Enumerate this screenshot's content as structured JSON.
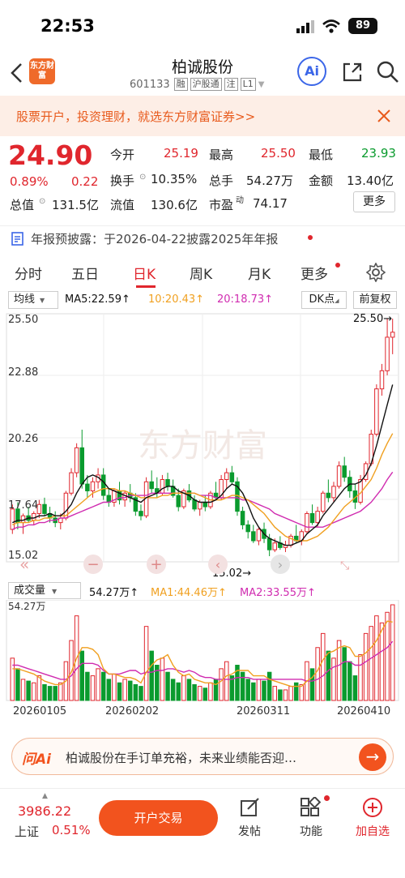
{
  "status_bar": {
    "time": "22:53",
    "battery": "89"
  },
  "header": {
    "logo_text": "东方财富",
    "title": "柏诚股份",
    "code": "601133",
    "tags": [
      "融",
      "沪股通",
      "注",
      "L1"
    ]
  },
  "promo": {
    "text": "股票开户，投资理财，就选东方财富证券>>"
  },
  "quote": {
    "price": "24.90",
    "change_pct": "0.89%",
    "change": "0.22",
    "open_label": "今开",
    "open": "25.19",
    "high_label": "最高",
    "high": "25.50",
    "low_label": "最低",
    "low": "23.93",
    "turnover_label": "换手",
    "turnover": "10.35%",
    "volume_label": "总手",
    "volume": "54.27万",
    "amount_label": "金额",
    "amount": "13.40亿",
    "total_cap_label": "总值",
    "total_cap": "131.5亿",
    "float_cap_label": "流值",
    "float_cap": "130.6亿",
    "pe_label": "市盈",
    "pe_sup": "动",
    "pe": "74.17",
    "more_label": "更多"
  },
  "notice": {
    "text": "年报预披露：于2026-04-22披露2025年年报"
  },
  "tabs": [
    {
      "label": "分时"
    },
    {
      "label": "五日"
    },
    {
      "label": "日K"
    },
    {
      "label": "周K"
    },
    {
      "label": "月K"
    },
    {
      "label": "更多"
    }
  ],
  "chart_controls": {
    "ma_select": "均线",
    "ma5": "MA5:22.59↑",
    "ma10": "10:20.43↑",
    "ma20": "20:18.73↑",
    "dk_label": "DK点",
    "adjust_label": "前复权"
  },
  "vol_controls": {
    "select": "成交量",
    "vol": "54.27万↑",
    "ma1": "MA1:44.46万↑",
    "ma2": "MA2:33.55万↑",
    "vol_max": "54.27万"
  },
  "colors": {
    "up": "#e0262d",
    "down": "#0a9b2e",
    "ma5": "#111111",
    "ma10": "#f0a020",
    "ma20": "#d02cb0",
    "accent": "#f2531e"
  },
  "chart_data": {
    "type": "candlestick",
    "y_ticks": [
      "25.50",
      "22.88",
      "20.26",
      "17.64",
      "15.02"
    ],
    "ylim": [
      15.02,
      25.5
    ],
    "max_label": "25.50→",
    "min_label": "15.02→",
    "watermark": "东方财富",
    "x_ticks": [
      "20260105",
      "20260202",
      "20260311",
      "20260410"
    ],
    "candles": [
      [
        16.2,
        17.3,
        16.0,
        17.1
      ],
      [
        17.1,
        17.4,
        16.2,
        16.5
      ],
      [
        16.5,
        16.9,
        16.0,
        16.8
      ],
      [
        16.8,
        17.2,
        16.5,
        16.6
      ],
      [
        16.6,
        17.0,
        16.4,
        16.9
      ],
      [
        16.9,
        17.5,
        16.7,
        17.3
      ],
      [
        17.3,
        17.6,
        16.8,
        16.9
      ],
      [
        16.9,
        17.2,
        16.5,
        16.7
      ],
      [
        16.7,
        17.0,
        16.3,
        16.5
      ],
      [
        16.5,
        16.9,
        16.2,
        16.7
      ],
      [
        16.7,
        17.9,
        16.6,
        17.8
      ],
      [
        17.8,
        18.9,
        17.7,
        18.7
      ],
      [
        18.7,
        20.0,
        18.5,
        19.8
      ],
      [
        19.8,
        20.6,
        18.0,
        18.2
      ],
      [
        18.2,
        18.6,
        17.6,
        17.9
      ],
      [
        17.9,
        18.5,
        17.6,
        18.3
      ],
      [
        18.3,
        18.9,
        18.0,
        18.6
      ],
      [
        18.6,
        18.9,
        17.5,
        17.7
      ],
      [
        17.7,
        18.0,
        17.2,
        17.4
      ],
      [
        17.4,
        18.0,
        17.2,
        17.9
      ],
      [
        17.9,
        18.3,
        17.3,
        17.5
      ],
      [
        17.5,
        17.9,
        17.2,
        17.8
      ],
      [
        17.8,
        18.2,
        17.4,
        17.6
      ],
      [
        17.6,
        17.8,
        16.8,
        17.0
      ],
      [
        17.0,
        17.3,
        16.6,
        16.8
      ],
      [
        16.8,
        18.5,
        16.7,
        18.3
      ],
      [
        18.3,
        18.8,
        17.8,
        18.0
      ],
      [
        18.0,
        18.5,
        17.6,
        17.8
      ],
      [
        17.8,
        18.6,
        17.7,
        18.4
      ],
      [
        18.4,
        18.7,
        17.9,
        18.1
      ],
      [
        18.1,
        18.4,
        17.6,
        17.7
      ],
      [
        17.7,
        18.0,
        17.0,
        17.2
      ],
      [
        17.2,
        18.0,
        17.1,
        17.9
      ],
      [
        17.9,
        18.2,
        17.4,
        17.5
      ],
      [
        17.5,
        17.7,
        17.0,
        17.1
      ],
      [
        17.1,
        17.5,
        16.8,
        17.4
      ],
      [
        17.4,
        17.7,
        17.0,
        17.2
      ],
      [
        17.2,
        17.9,
        17.1,
        17.8
      ],
      [
        17.8,
        18.3,
        17.5,
        17.6
      ],
      [
        17.6,
        18.6,
        17.5,
        18.4
      ],
      [
        18.4,
        18.9,
        18.0,
        18.7
      ],
      [
        18.7,
        19.0,
        18.2,
        18.3
      ],
      [
        18.3,
        18.5,
        16.8,
        17.0
      ],
      [
        17.0,
        17.2,
        16.2,
        16.4
      ],
      [
        16.4,
        16.6,
        15.8,
        16.1
      ],
      [
        16.1,
        16.4,
        15.6,
        15.7
      ],
      [
        15.7,
        16.3,
        15.5,
        16.2
      ],
      [
        16.2,
        16.5,
        15.6,
        15.8
      ],
      [
        15.8,
        16.0,
        15.02,
        15.3
      ],
      [
        15.3,
        15.8,
        15.2,
        15.6
      ],
      [
        15.6,
        15.9,
        15.3,
        15.4
      ],
      [
        15.4,
        15.7,
        15.2,
        15.5
      ],
      [
        15.5,
        16.0,
        15.4,
        15.9
      ],
      [
        15.9,
        16.4,
        15.6,
        15.7
      ],
      [
        15.7,
        16.2,
        15.5,
        16.1
      ],
      [
        16.1,
        17.0,
        16.0,
        16.9
      ],
      [
        16.9,
        17.3,
        16.4,
        16.5
      ],
      [
        16.5,
        17.2,
        16.3,
        17.0
      ],
      [
        17.0,
        17.9,
        16.9,
        17.8
      ],
      [
        17.8,
        18.4,
        17.4,
        17.6
      ],
      [
        17.6,
        18.3,
        17.4,
        18.1
      ],
      [
        18.1,
        19.2,
        18.0,
        19.0
      ],
      [
        19.0,
        19.4,
        18.3,
        18.5
      ],
      [
        18.5,
        18.8,
        17.6,
        17.9
      ],
      [
        17.9,
        18.2,
        17.1,
        17.4
      ],
      [
        17.4,
        18.6,
        17.3,
        18.4
      ],
      [
        18.4,
        19.2,
        18.3,
        19.1
      ],
      [
        19.1,
        20.6,
        19.0,
        20.4
      ],
      [
        20.4,
        22.6,
        20.3,
        22.4
      ],
      [
        22.4,
        23.5,
        22.1,
        23.2
      ],
      [
        23.2,
        25.5,
        23.0,
        24.68
      ],
      [
        24.68,
        25.5,
        23.93,
        24.9
      ]
    ],
    "volumes": [
      24,
      18,
      12,
      11,
      10,
      14,
      9,
      8,
      8,
      10,
      22,
      34,
      48,
      28,
      16,
      14,
      18,
      16,
      12,
      15,
      10,
      12,
      11,
      9,
      8,
      42,
      28,
      20,
      24,
      16,
      12,
      10,
      14,
      12,
      9,
      8,
      7,
      10,
      12,
      18,
      22,
      14,
      20,
      16,
      12,
      10,
      12,
      11,
      16,
      8,
      6,
      6,
      8,
      10,
      9,
      22,
      18,
      30,
      38,
      28,
      24,
      34,
      30,
      22,
      14,
      26,
      38,
      42,
      48,
      44,
      50,
      54.27
    ],
    "ma5": [
      16.5,
      16.6,
      16.6,
      16.7,
      16.7,
      16.8,
      16.8,
      16.9,
      16.8,
      16.8,
      17.0,
      17.3,
      17.8,
      18.2,
      18.5,
      18.6,
      18.5,
      18.3,
      18.0,
      17.9,
      17.8,
      17.7,
      17.6,
      17.5,
      17.4,
      17.6,
      17.7,
      17.8,
      18.0,
      18.1,
      18.1,
      17.9,
      17.8,
      17.7,
      17.5,
      17.4,
      17.4,
      17.4,
      17.5,
      17.7,
      18.0,
      18.2,
      18.1,
      17.8,
      17.3,
      16.7,
      16.3,
      16.0,
      15.8,
      15.7,
      15.6,
      15.5,
      15.5,
      15.6,
      15.7,
      16.0,
      16.2,
      16.4,
      16.8,
      17.1,
      17.4,
      17.7,
      18.0,
      18.2,
      18.2,
      18.3,
      18.6,
      19.1,
      19.9,
      20.8,
      21.7,
      22.59
    ],
    "ma10": [
      16.4,
      16.5,
      16.5,
      16.5,
      16.6,
      16.6,
      16.7,
      16.7,
      16.8,
      16.8,
      16.8,
      17.0,
      17.2,
      17.4,
      17.6,
      17.8,
      17.9,
      18.0,
      18.0,
      18.0,
      17.9,
      17.9,
      17.8,
      17.7,
      17.6,
      17.6,
      17.6,
      17.6,
      17.7,
      17.7,
      17.8,
      17.8,
      17.8,
      17.8,
      17.8,
      17.7,
      17.6,
      17.5,
      17.5,
      17.5,
      17.6,
      17.7,
      17.7,
      17.6,
      17.5,
      17.3,
      17.1,
      16.9,
      16.6,
      16.3,
      16.1,
      15.9,
      15.8,
      15.7,
      15.7,
      15.7,
      15.8,
      15.9,
      16.1,
      16.3,
      16.6,
      16.9,
      17.2,
      17.4,
      17.6,
      17.8,
      18.1,
      18.4,
      18.9,
      19.5,
      20.0,
      20.43
    ],
    "ma20": [
      16.2,
      16.3,
      16.3,
      16.4,
      16.4,
      16.5,
      16.5,
      16.6,
      16.6,
      16.7,
      16.7,
      16.8,
      16.9,
      17.0,
      17.1,
      17.2,
      17.3,
      17.4,
      17.4,
      17.5,
      17.6,
      17.6,
      17.7,
      17.7,
      17.7,
      17.7,
      17.8,
      17.8,
      17.8,
      17.8,
      17.8,
      17.8,
      17.8,
      17.8,
      17.8,
      17.7,
      17.7,
      17.7,
      17.6,
      17.6,
      17.6,
      17.6,
      17.6,
      17.5,
      17.5,
      17.4,
      17.3,
      17.2,
      17.1,
      16.9,
      16.8,
      16.7,
      16.6,
      16.5,
      16.4,
      16.3,
      16.3,
      16.3,
      16.3,
      16.4,
      16.5,
      16.6,
      16.7,
      16.8,
      16.9,
      17.0,
      17.2,
      17.4,
      17.7,
      18.0,
      18.4,
      18.73
    ],
    "vol_ma1": [
      18,
      18,
      17,
      16,
      15,
      13,
      11,
      10,
      9,
      9,
      11,
      16,
      24,
      30,
      30,
      29,
      26,
      18,
      15,
      15,
      14,
      13,
      13,
      12,
      10,
      16,
      20,
      23,
      24,
      26,
      20,
      16,
      14,
      15,
      12,
      11,
      10,
      10,
      9,
      11,
      14,
      15,
      17,
      17,
      17,
      14,
      14,
      14,
      12,
      11,
      10,
      9,
      8,
      8,
      8,
      11,
      13,
      17,
      23,
      27,
      28,
      30,
      31,
      30,
      25,
      25,
      27,
      30,
      34,
      40,
      45,
      44.46
    ],
    "vol_ma2": [
      20,
      20,
      19,
      18,
      17,
      16,
      15,
      14,
      13,
      12,
      12,
      14,
      18,
      21,
      21,
      21,
      20,
      17,
      15,
      15,
      15,
      16,
      17,
      17,
      15,
      16,
      16,
      17,
      17,
      18,
      18,
      17,
      16,
      17,
      16,
      14,
      13,
      13,
      12,
      12,
      12,
      12,
      13,
      13,
      13,
      12,
      12,
      12,
      12,
      12,
      12,
      12,
      12,
      12,
      12,
      11,
      11,
      12,
      14,
      17,
      19,
      20,
      22,
      22,
      20,
      20,
      22,
      24,
      26,
      28,
      30,
      33.55
    ]
  },
  "ai_bar": {
    "label": "问Ai",
    "text": "柏诚股份在手订单充裕，未来业绩能否迎…"
  },
  "bottom_bar": {
    "index_value": "3986.22",
    "index_name": "上证",
    "index_change": "0.51%",
    "trade_label": "开户交易",
    "post_label": "发帖",
    "func_label": "功能",
    "watch_label": "加自选"
  }
}
